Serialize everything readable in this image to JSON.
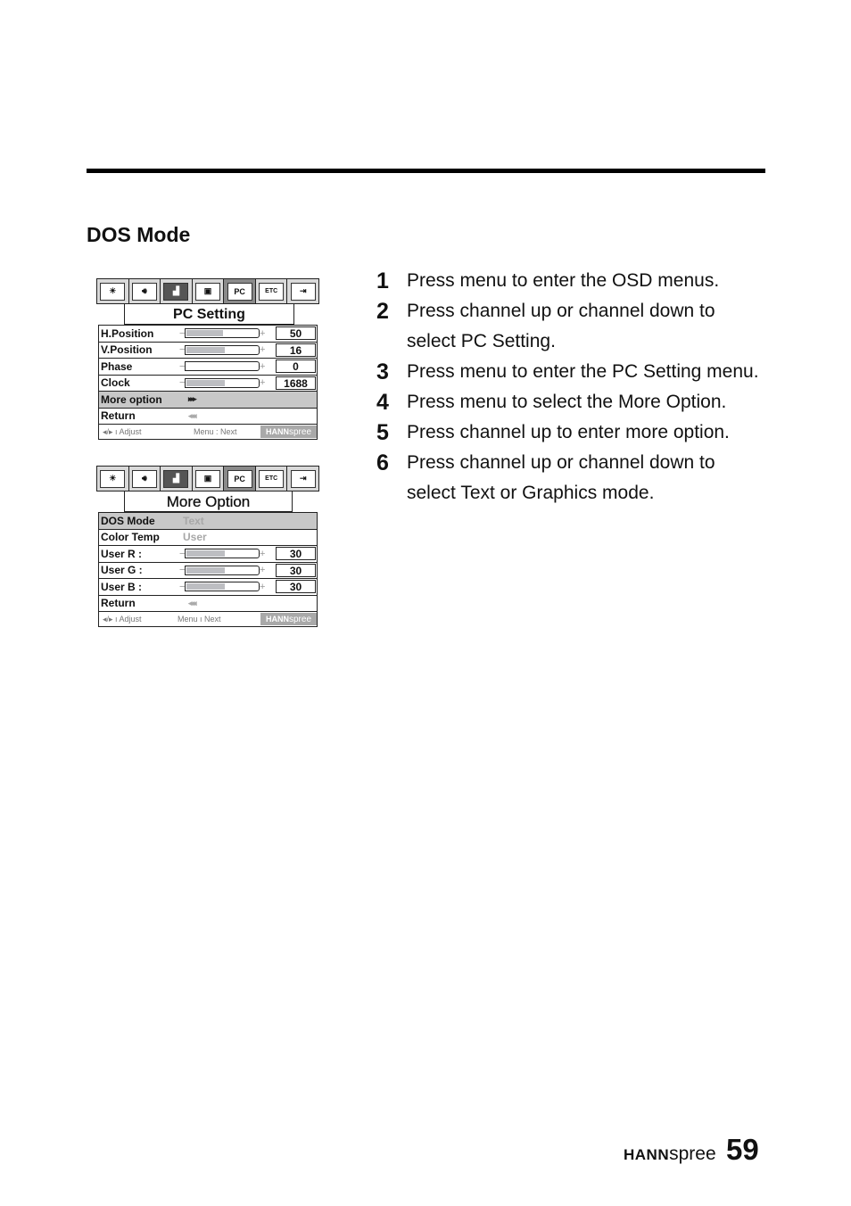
{
  "section_title": "DOS Mode",
  "osd_tabs": [
    {
      "icon": "brightness-icon",
      "label": ""
    },
    {
      "icon": "sound-icon",
      "label": ""
    },
    {
      "icon": "picture-icon",
      "label": ""
    },
    {
      "icon": "tv-icon",
      "label": ""
    },
    {
      "icon": "pc-icon",
      "label": "PC"
    },
    {
      "icon": "etc-icon",
      "label": "ETC"
    },
    {
      "icon": "exit-icon",
      "label": ""
    }
  ],
  "pc_setting": {
    "title": "PC Setting",
    "active_tab": "PC",
    "rows": [
      {
        "label": "H.Position",
        "value": "50",
        "level": 0.5
      },
      {
        "label": "V.Position",
        "value": "16",
        "level": 0.52
      },
      {
        "label": "Phase",
        "value": "0",
        "level": 0.0
      },
      {
        "label": "Clock",
        "value": "1688",
        "level": 0.52
      }
    ],
    "more_option": "More option",
    "more_arrows": "▸▸▸",
    "return_label": "Return",
    "return_arrows": "◂◂◂",
    "footer": {
      "adjust": "◂/▸ ı Adjust",
      "next": "Menu : Next",
      "brand_bold": "HANN",
      "brand_light": "spree"
    }
  },
  "more_option": {
    "title": "More Option",
    "active_tab": "PC",
    "dos_mode": {
      "label": "DOS Mode",
      "value": "Text"
    },
    "color_temp": {
      "label": "Color Temp",
      "value": "User"
    },
    "rows": [
      {
        "label": "User R :",
        "value": "30",
        "level": 0.52
      },
      {
        "label": "User G :",
        "value": "30",
        "level": 0.52
      },
      {
        "label": "User B :",
        "value": "30",
        "level": 0.52
      }
    ],
    "return_label": "Return",
    "return_arrows": "◂◂◂",
    "footer": {
      "adjust": "◂/▸ ı Adjust",
      "next": "Menu ı Next",
      "brand_bold": "HANN",
      "brand_light": "spree"
    }
  },
  "steps": [
    {
      "num": "1",
      "text": "Press menu to enter the OSD menus."
    },
    {
      "num": "2",
      "text": "Press channel up or channel down to select PC Setting."
    },
    {
      "num": "3",
      "text": "Press menu to enter the PC Setting menu."
    },
    {
      "num": "4",
      "text": "Press menu to select the More Option."
    },
    {
      "num": "5",
      "text": "Press channel up to enter more option."
    },
    {
      "num": "6",
      "text": "Press channel up or channel down to select Text or Graphics mode."
    }
  ],
  "footer": {
    "brand_bold": "HANN",
    "brand_light": "spree",
    "page_number": "59"
  }
}
